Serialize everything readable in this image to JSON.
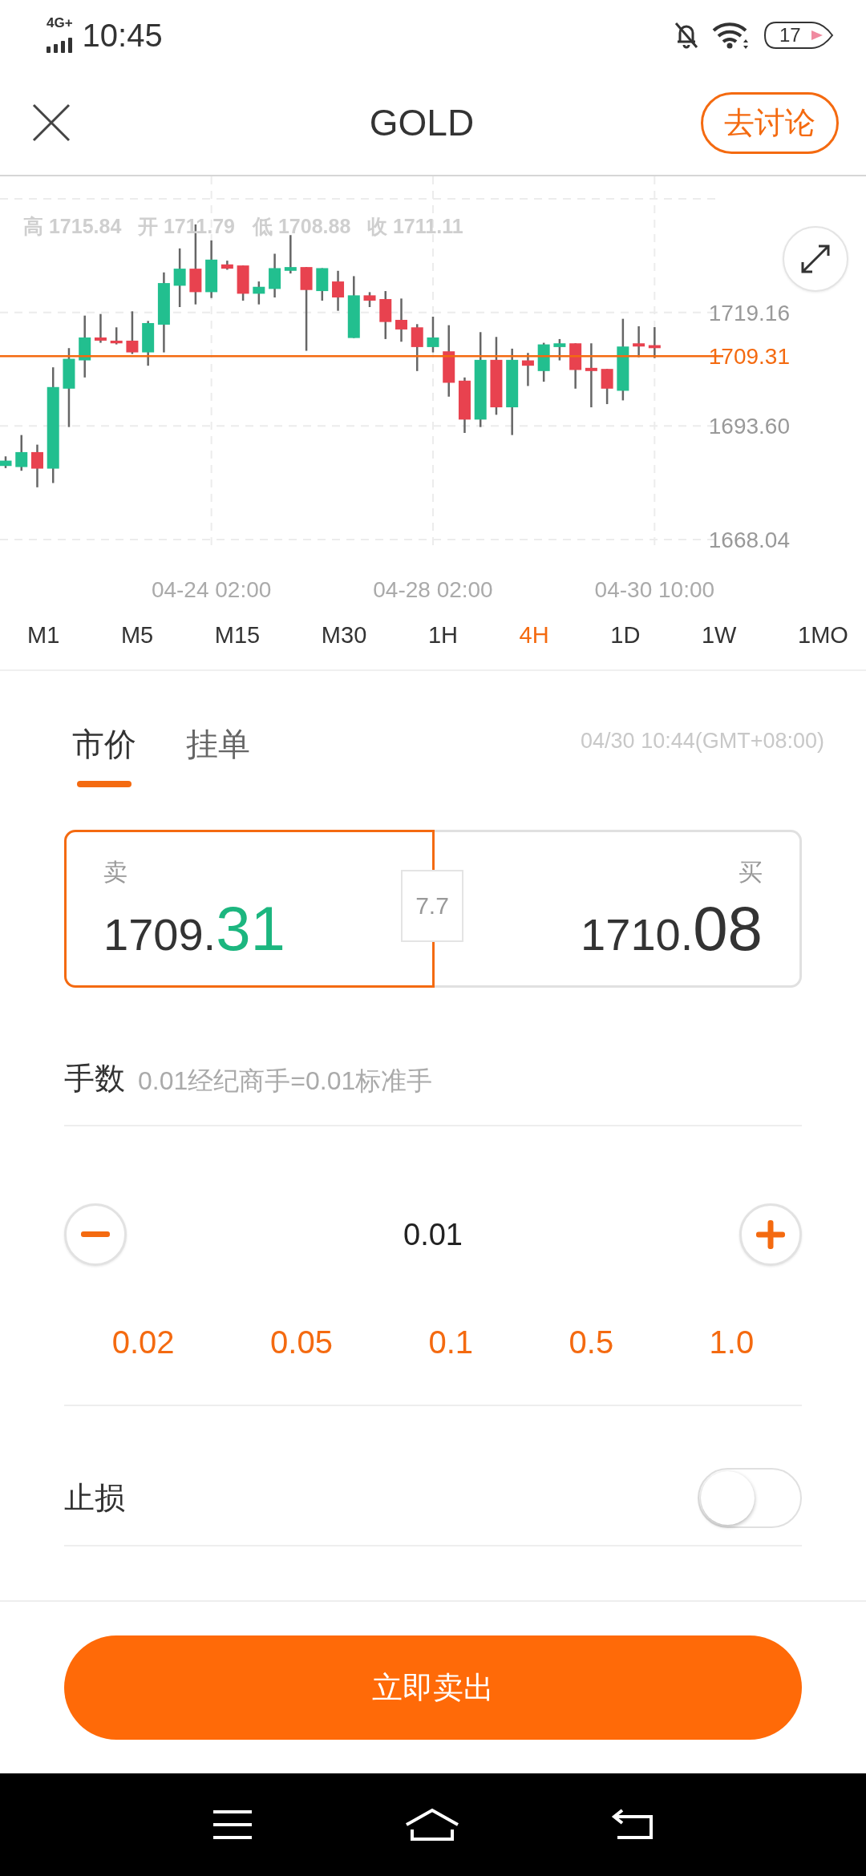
{
  "status_bar": {
    "network": "4G+",
    "time": "10:45",
    "battery": "17"
  },
  "header": {
    "title": "GOLD",
    "action": "去讨论"
  },
  "chart": {
    "readout": [
      {
        "label": "高",
        "value": "1715.84"
      },
      {
        "label": "开",
        "value": "1711.79"
      },
      {
        "label": "低",
        "value": "1708.88"
      },
      {
        "label": "收",
        "value": "1711.11"
      }
    ],
    "chart_data": {
      "type": "candlestick",
      "categories": [
        null,
        null,
        null,
        null,
        null,
        null,
        null,
        null,
        null,
        null,
        null,
        null,
        null,
        "04-24 02:00",
        null,
        null,
        null,
        null,
        null,
        null,
        null,
        null,
        null,
        null,
        null,
        null,
        null,
        "04-28 02:00",
        null,
        null,
        null,
        null,
        null,
        null,
        null,
        null,
        null,
        null,
        null,
        null,
        null,
        "04-30 10:00"
      ],
      "ohlc": [
        [
          1684.6,
          1686.76,
          1684.12,
          1685.8
        ],
        [
          1684.36,
          1691.56,
          1683.52,
          1687.72
        ],
        [
          1687.72,
          1689.4,
          1679.8,
          1684.0
        ],
        [
          1684.0,
          1706.8,
          1680.76,
          1702.36
        ],
        [
          1702.0,
          1711.12,
          1693.36,
          1708.72
        ],
        [
          1708.36,
          1718.44,
          1704.52,
          1713.52
        ],
        [
          1713.52,
          1718.8,
          1712.32,
          1712.8
        ],
        [
          1712.8,
          1715.8,
          1711.96,
          1712.2
        ],
        [
          1712.8,
          1719.4,
          1709.8,
          1710.16
        ],
        [
          1710.16,
          1717.24,
          1707.16,
          1716.76
        ],
        [
          1716.4,
          1728.16,
          1710.16,
          1725.76
        ],
        [
          1725.16,
          1733.56,
          1720.36,
          1729.0
        ],
        [
          1729.0,
          1738.96,
          1720.96,
          1723.72
        ],
        [
          1723.72,
          1735.36,
          1722.4,
          1731.04
        ],
        [
          1729.96,
          1730.8,
          1728.76,
          1729.0
        ],
        [
          1729.72,
          1729.72,
          1721.8,
          1723.36
        ],
        [
          1723.36,
          1726.12,
          1720.96,
          1724.92
        ],
        [
          1724.44,
          1732.36,
          1722.52,
          1729.12
        ],
        [
          1728.52,
          1736.56,
          1727.92,
          1729.36
        ],
        [
          1729.36,
          1729.36,
          1710.52,
          1724.2
        ],
        [
          1723.96,
          1729.12,
          1721.8,
          1729.12
        ],
        [
          1726.12,
          1728.52,
          1719.52,
          1722.52
        ],
        [
          1713.4,
          1727.32,
          1713.4,
          1723.0
        ],
        [
          1723.0,
          1723.72,
          1720.36,
          1721.8
        ],
        [
          1722.16,
          1723.96,
          1713.16,
          1717.0
        ],
        [
          1717.48,
          1722.28,
          1712.56,
          1715.32
        ],
        [
          1715.8,
          1716.52,
          1705.96,
          1711.36
        ],
        [
          1711.36,
          1718.2,
          1710.16,
          1713.52
        ],
        [
          1710.4,
          1716.28,
          1700.2,
          1703.32
        ],
        [
          1703.8,
          1704.52,
          1692.04,
          1695.04
        ],
        [
          1695.04,
          1714.72,
          1693.36,
          1708.48
        ],
        [
          1708.48,
          1713.64,
          1696.12,
          1697.8
        ],
        [
          1697.8,
          1711.0,
          1691.56,
          1708.48
        ],
        [
          1708.36,
          1710.04,
          1702.6,
          1707.16
        ],
        [
          1705.96,
          1712.32,
          1703.56,
          1711.96
        ],
        [
          1711.36,
          1713.16,
          1708.36,
          1712.2
        ],
        [
          1712.2,
          1712.2,
          1702.0,
          1706.2
        ],
        [
          1706.68,
          1712.2,
          1697.8,
          1705.96
        ],
        [
          1706.44,
          1706.44,
          1698.52,
          1702.0
        ],
        [
          1701.52,
          1717.72,
          1699.36,
          1711.48
        ],
        [
          1712.2,
          1716.04,
          1709.08,
          1711.48
        ],
        [
          1711.79,
          1715.84,
          1708.88,
          1711.11
        ]
      ],
      "ylim": [
        1668.04,
        1744.72
      ],
      "yticks": [
        {
          "value": 1719.16,
          "label": "1719.16"
        },
        {
          "value": 1693.6,
          "label": "1693.60"
        },
        {
          "value": 1668.04,
          "label": "1668.04"
        }
      ],
      "grid": true,
      "ref_lines": [
        {
          "axis": "y",
          "value": 1709.31,
          "label": "1709.31",
          "color": "#f46a10"
        }
      ]
    }
  },
  "timeframes": [
    {
      "label": "M1",
      "selected": false
    },
    {
      "label": "M5",
      "selected": false
    },
    {
      "label": "M15",
      "selected": false
    },
    {
      "label": "M30",
      "selected": false
    },
    {
      "label": "1H",
      "selected": false
    },
    {
      "label": "4H",
      "selected": true
    },
    {
      "label": "1D",
      "selected": false
    },
    {
      "label": "1W",
      "selected": false
    },
    {
      "label": "1MO",
      "selected": false
    }
  ],
  "order_tabs": [
    {
      "label": "市价",
      "selected": true
    },
    {
      "label": "挂单",
      "selected": false
    }
  ],
  "timestamp": "04/30 10:44(GMT+08:00)",
  "quotes": {
    "sell": {
      "label": "卖",
      "price_main": "1709.",
      "price_tail": "31",
      "color": "#1cb67f",
      "selected": true
    },
    "spread": "7.7",
    "buy": {
      "label": "买",
      "price_main": "1710.",
      "price_tail": "08",
      "color": "#333333",
      "selected": false
    }
  },
  "lots": {
    "label": "手数",
    "hint": "0.01经纪商手=0.01标准手",
    "value": "0.01",
    "presets": [
      "0.02",
      "0.05",
      "0.1",
      "0.5",
      "1.0"
    ]
  },
  "stop_loss": {
    "label": "止损",
    "on": false
  },
  "submit": "立即卖出"
}
